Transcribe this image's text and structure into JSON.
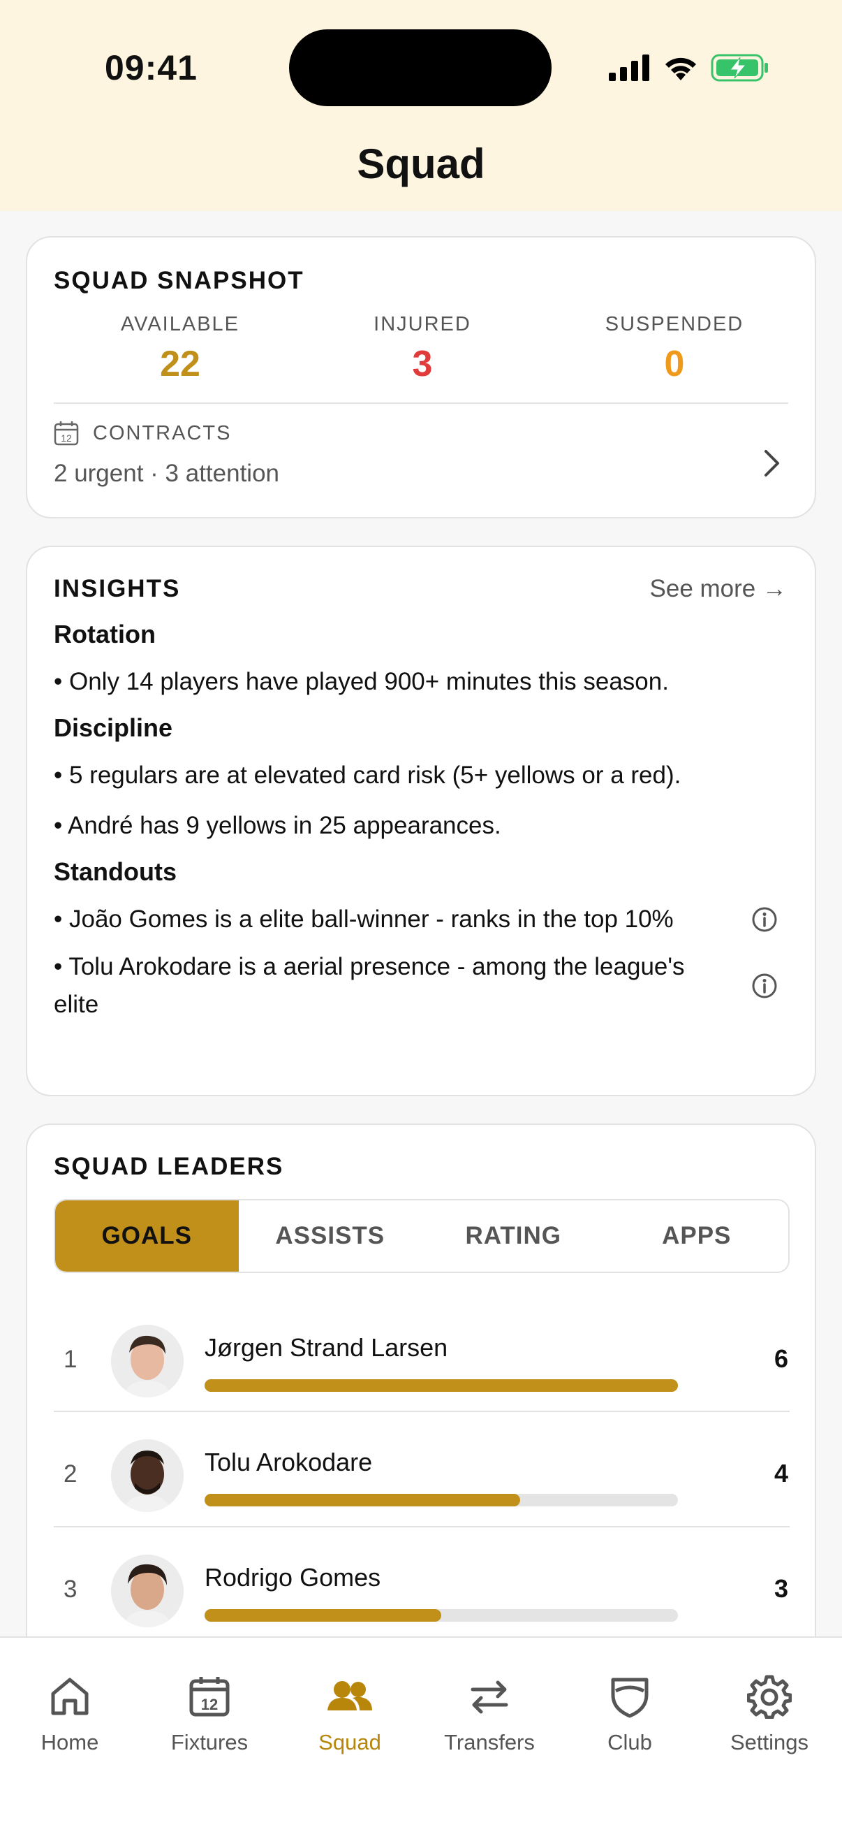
{
  "status_bar": {
    "time": "09:41"
  },
  "header": {
    "title": "Squad"
  },
  "snapshot": {
    "title": "SQUAD SNAPSHOT",
    "stats": [
      {
        "label": "AVAILABLE",
        "value": "22",
        "color": "#c0901a"
      },
      {
        "label": "INJURED",
        "value": "3",
        "color": "#e03a3a"
      },
      {
        "label": "SUSPENDED",
        "value": "0",
        "color": "#ef9a1a"
      }
    ],
    "contracts": {
      "icon_day": "12",
      "label": "CONTRACTS",
      "detail": "2 urgent · 3 attention"
    }
  },
  "insights": {
    "title": "INSIGHTS",
    "see_more": "See more →",
    "sections": [
      {
        "heading": "Rotation",
        "items": [
          "• Only 14 players have played 900+ minutes this season."
        ]
      },
      {
        "heading": "Discipline",
        "items": [
          "• 5 regulars are at elevated card risk (5+ yellows or a red).",
          "• André has 9 yellows in 25 appearances."
        ]
      },
      {
        "heading": "Standouts",
        "items": [
          "• João Gomes is a elite ball-winner - ranks in the top 10%",
          "• Tolu Arokodare is a aerial presence - among the league's elite"
        ]
      }
    ]
  },
  "leaders": {
    "title": "SQUAD LEADERS",
    "tabs": [
      "GOALS",
      "ASSISTS",
      "RATING",
      "APPS"
    ],
    "active_tab": "GOALS",
    "accent": "#c0901a",
    "rows": [
      {
        "rank": "1",
        "name": "Jørgen Strand Larsen",
        "value": "6",
        "fraction": 1.0
      },
      {
        "rank": "2",
        "name": "Tolu Arokodare",
        "value": "4",
        "fraction": 0.667
      },
      {
        "rank": "3",
        "name": "Rodrigo Gomes",
        "value": "3",
        "fraction": 0.5
      }
    ]
  },
  "nav": {
    "items": [
      {
        "label": "Home",
        "icon": "home-icon"
      },
      {
        "label": "Fixtures",
        "icon": "calendar-icon",
        "icon_day": "12"
      },
      {
        "label": "Squad",
        "icon": "squad-icon",
        "active": true
      },
      {
        "label": "Transfers",
        "icon": "transfers-icon"
      },
      {
        "label": "Club",
        "icon": "shield-icon"
      },
      {
        "label": "Settings",
        "icon": "gear-icon"
      }
    ]
  }
}
